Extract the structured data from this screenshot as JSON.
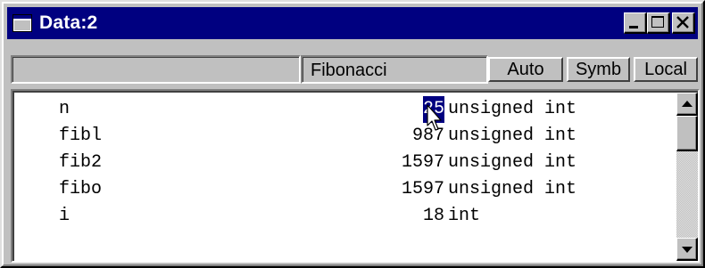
{
  "window": {
    "title": "Data:2",
    "icons": {
      "app": "window-icon",
      "minimize": "minimize-icon",
      "maximize": "maximize-icon",
      "close": "close-icon"
    }
  },
  "header": {
    "context_value": "",
    "function_name": "Fibonacci",
    "buttons": {
      "auto": "Auto",
      "symb": "Symb",
      "local": "Local"
    }
  },
  "variables": [
    {
      "name": "n",
      "value": "25",
      "type": "unsigned int",
      "selected": true
    },
    {
      "name": "fibl",
      "value": "987",
      "type": "unsigned int"
    },
    {
      "name": "fib2",
      "value": "1597",
      "type": "unsigned int"
    },
    {
      "name": "fibo",
      "value": "1597",
      "type": "unsigned int"
    },
    {
      "name": "i",
      "value": "18",
      "type": "int"
    }
  ],
  "colors": {
    "titlebar": "#000080",
    "selection": "#000080",
    "face": "#c0c0c0"
  }
}
